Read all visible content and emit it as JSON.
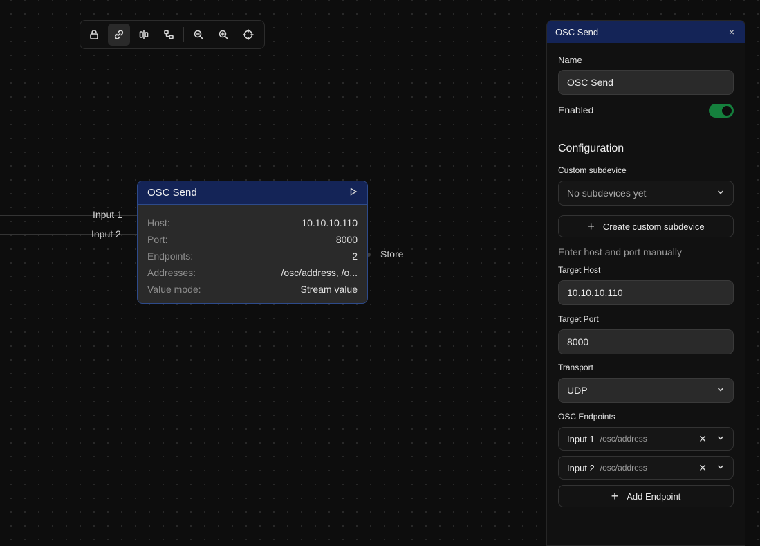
{
  "toolbar": {
    "buttons": [
      {
        "name": "lock-icon"
      },
      {
        "name": "link-icon"
      },
      {
        "name": "align-icon"
      },
      {
        "name": "layout-icon"
      },
      {
        "name": "zoom-out-icon"
      },
      {
        "name": "zoom-in-icon"
      },
      {
        "name": "crosshair-icon"
      }
    ]
  },
  "canvas": {
    "inputs": [
      "Input 1",
      "Input 2"
    ],
    "output": "Store"
  },
  "node": {
    "title": "OSC Send",
    "rows": [
      {
        "key": "Host:",
        "value": "10.10.10.110"
      },
      {
        "key": "Port:",
        "value": "8000"
      },
      {
        "key": "Endpoints:",
        "value": "2"
      },
      {
        "key": "Addresses:",
        "value": "/osc/address, /o..."
      },
      {
        "key": "Value mode:",
        "value": "Stream value"
      }
    ]
  },
  "panel": {
    "title": "OSC Send",
    "close": "×",
    "name_label": "Name",
    "name_value": "OSC Send",
    "enabled_label": "Enabled",
    "enabled": true,
    "config_title": "Configuration",
    "subdevice_label": "Custom subdevice",
    "subdevice_value": "No subdevices yet",
    "create_subdevice": "Create custom subdevice",
    "manual_hint": "Enter host and port manually",
    "host_label": "Target Host",
    "host_value": "10.10.10.110",
    "port_label": "Target Port",
    "port_value": "8000",
    "transport_label": "Transport",
    "transport_value": "UDP",
    "endpoints_label": "OSC Endpoints",
    "endpoints": [
      {
        "name": "Input 1",
        "address": "/osc/address"
      },
      {
        "name": "Input 2",
        "address": "/osc/address"
      }
    ],
    "add_endpoint": "Add Endpoint",
    "plus": "+",
    "remove": "✕"
  },
  "colors": {
    "accent": "#142457",
    "toggle_on": "#15803d"
  }
}
